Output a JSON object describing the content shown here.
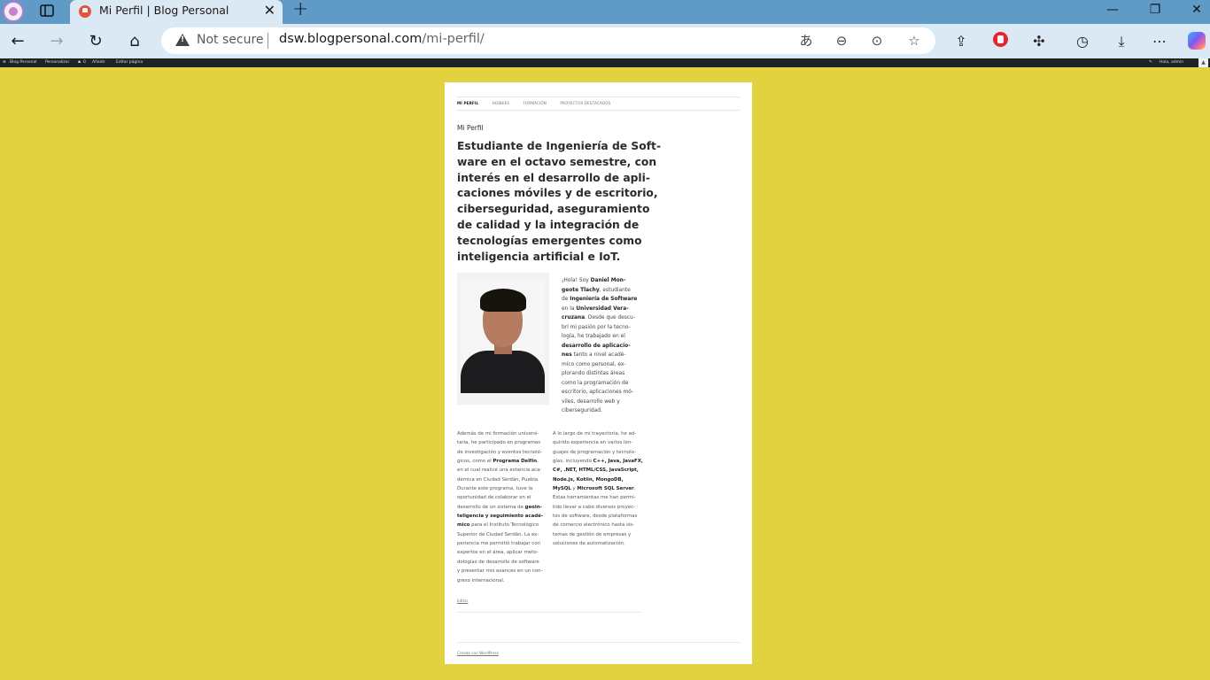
{
  "browser": {
    "tab_title": "Mi Perfil | Blog Personal",
    "security_label": "Not secure",
    "url_host": "dsw.blogpersonal.com",
    "url_path": "/mi-perfil/"
  },
  "wp_admin_bar": {
    "site_name": "Blog Personal",
    "customize": "Personalizar",
    "comments_count": "0",
    "new": "Añadir",
    "edit_page": "Editar página",
    "greeting": "Hola, admin"
  },
  "site_menu": [
    "MI PERFIL",
    "HOBBIES",
    "FORMACIÓN",
    "PROYECTOS DESTACADOS"
  ],
  "page": {
    "entry_title": "Mi Perfil",
    "lead_lines": [
      "Estudiante de Ingeniería de Soft-",
      "ware en el octavo semestre, con",
      "interés en el desarrollo de apli-",
      "caciones móviles y de escritorio,",
      "ciberseguridad, aseguramiento",
      "de calidad y la integración de",
      "tecnologías emergentes como",
      "inteligencia artificial e IoT."
    ],
    "intro": {
      "l1_a": "¡Hola! Soy ",
      "l1_b": "Daniel Mon-",
      "l2_a": "geote Tlachy",
      "l2_b": ", estudiante",
      "l3_a": "de ",
      "l3_b": "Ingeniería de Software",
      "l4_a": "en la ",
      "l4_b": "Universidad Vera-",
      "l5_a": "cruzana",
      "l5_b": ". Desde que descu-",
      "l6": "brí mi pasión por la tecno-",
      "l7": "logía, he trabajado en el",
      "l8": "desarrollo de aplicacio-",
      "l9_a": "nes",
      "l9_b": " tanto a nivel acadé-",
      "l10": "mico como personal, ex-",
      "l11": "plorando distintas áreas",
      "l12": "como la programación de",
      "l13": "escritorio, aplicaciones mó-",
      "l14": "viles, desarrollo web y",
      "l15": "ciberseguridad."
    },
    "col1": {
      "l1": "Además de mi formación universi-",
      "l2": "taria, he participado en programas",
      "l3": "de investigación y eventos tecnoló-",
      "l4_a": "gicos, como el ",
      "l4_b": "Programa Delfín",
      "l4_c": ",",
      "l5": "en el cual realicé una estancia aca-",
      "l6": "démica en Ciudad Serdán, Puebla.",
      "l7": "Durante este programa, tuve la",
      "l8": "oportunidad de colaborar en el",
      "l9_a": "desarrollo de un sistema de ",
      "l9_b": "geoin-",
      "l10": "teligencia y seguimiento acadé-",
      "l11_a": "mico",
      "l11_b": " para el Instituto Tecnológico",
      "l12": "Superior de Ciudad Serdán. La ex-",
      "l13": "periencia me permitió trabajar con",
      "l14": "expertos en el área, aplicar meto-",
      "l15": "dologías de desarrollo de software",
      "l16": "y presentar mis avances en un con-",
      "l17": "greso internacional."
    },
    "col2": {
      "l1": "A lo largo de mi trayectoria, he ad-",
      "l2": "quirido experiencia en varios len-",
      "l3": "guajes de programación y tecnolo-",
      "l4_a": "gías, incluyendo ",
      "l4_b": "C++, Java, JavaFX,",
      "l5": "C#, .NET, HTML/CSS, JavaScript,",
      "l6": "Node.js, Kotlin, MongoDB,",
      "l7_a": "MySQL",
      "l7_b": " y ",
      "l7_c": "Microsoft SQL Server",
      "l7_d": ".",
      "l8": "Estas herramientas me han permi-",
      "l9": "tido llevar a cabo diversos proyec-",
      "l10": "tos de software, desde plataformas",
      "l11": "de comercio electrónico hasta sis-",
      "l12": "temas de gestión de empresas y",
      "l13": "soluciones de automatización."
    },
    "edit_link": "Editar",
    "footer_credit": "Creado con WordPress"
  }
}
